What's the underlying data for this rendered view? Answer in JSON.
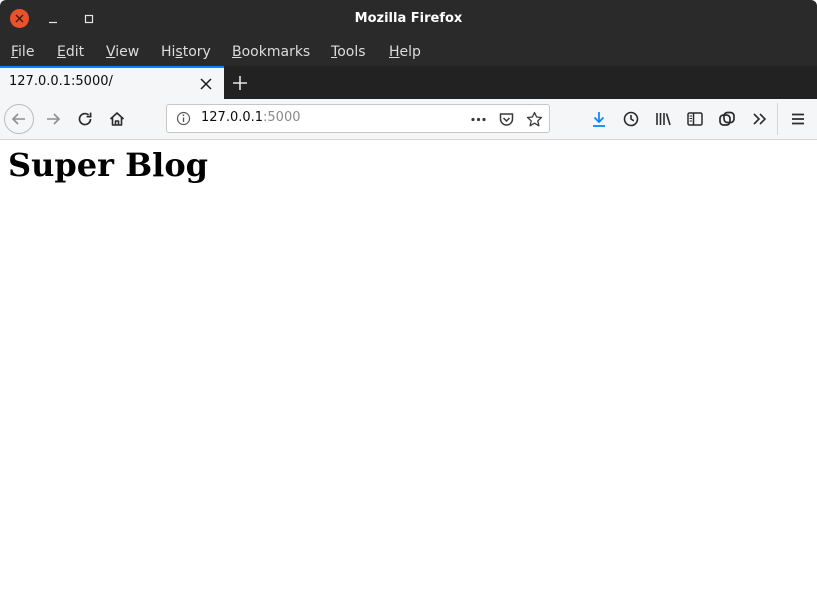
{
  "window": {
    "title": "Mozilla Firefox"
  },
  "menu": {
    "file": {
      "u": "F",
      "rest": "ile"
    },
    "edit": {
      "u": "E",
      "rest": "dit"
    },
    "view": {
      "u": "V",
      "rest": "iew"
    },
    "history": {
      "pre": "Hi",
      "u": "s",
      "rest": "tory"
    },
    "bookmarks": {
      "u": "B",
      "rest": "ookmarks"
    },
    "tools": {
      "u": "T",
      "rest": "ools"
    },
    "help": {
      "u": "H",
      "rest": "elp"
    }
  },
  "tab": {
    "title": "127.0.0.1:5000/"
  },
  "urlbar": {
    "host": "127.0.0.1",
    "port": ":5000"
  },
  "page": {
    "heading": "Super Blog"
  },
  "colors": {
    "accent": "#0a84ff",
    "close_button": "#e9522a",
    "titlebar": "#2b2a2b"
  },
  "icons": {
    "back": "back-arrow-icon",
    "forward": "forward-arrow-icon",
    "reload": "reload-icon",
    "home": "home-icon",
    "info": "info-icon",
    "page_actions": "more-dots-icon",
    "pocket": "pocket-icon",
    "bookmark": "star-icon",
    "downloads": "download-icon",
    "history": "clock-icon",
    "library": "library-icon",
    "sidebar": "sidebar-icon",
    "sync": "sync-icon",
    "overflow": "overflow-chevrons-icon",
    "menu": "hamburger-menu-icon"
  }
}
